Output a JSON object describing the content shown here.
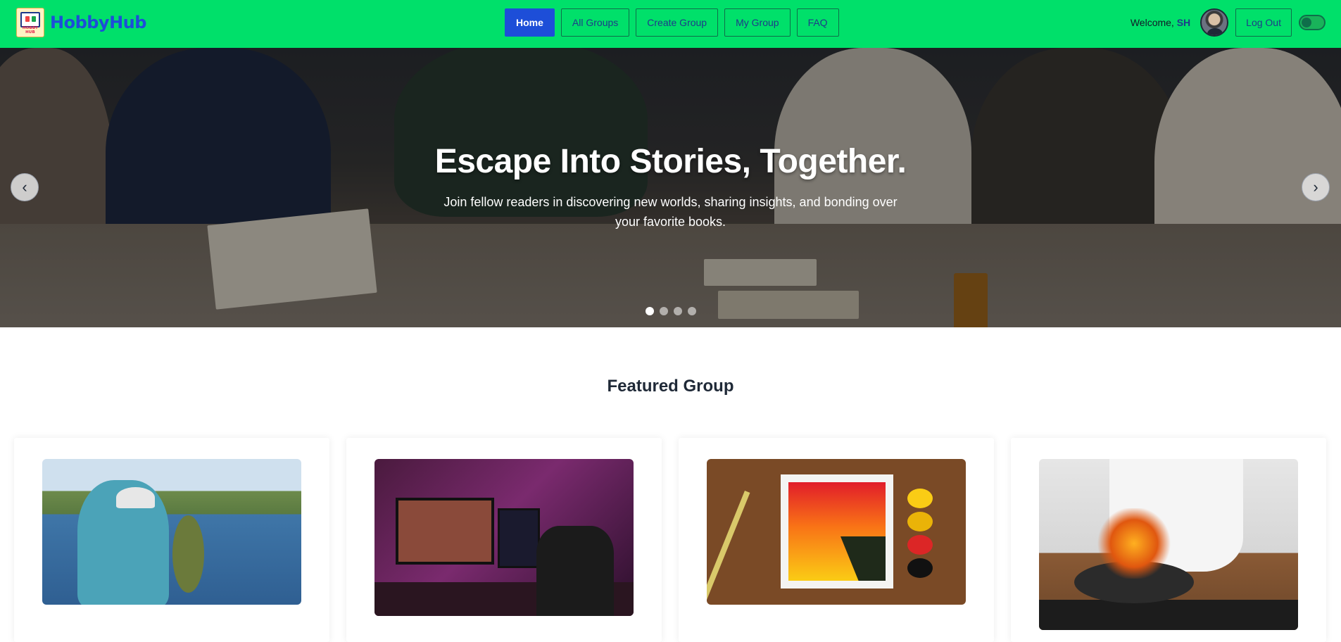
{
  "brand": {
    "logo_text": "HOBBY HUB",
    "name": "HobbyHub"
  },
  "nav": {
    "links": [
      "Home",
      "All Groups",
      "Create Group",
      "My Group",
      "FAQ"
    ],
    "active": "Home"
  },
  "user": {
    "welcome_prefix": "Welcome,",
    "name": "SH",
    "logout_label": "Log Out",
    "theme_toggle_on": false
  },
  "hero": {
    "title": "Escape Into Stories, Together.",
    "subtitle": "Join fellow readers in discovering new worlds, sharing insights, and bonding over your favorite books.",
    "prev_icon": "‹",
    "next_icon": "›",
    "slide_count": 4,
    "active_slide": 1
  },
  "featured": {
    "title": "Featured Group",
    "cards": [
      {
        "image": "fishing-photo"
      },
      {
        "image": "gaming-photo"
      },
      {
        "image": "painting-photo"
      },
      {
        "image": "cooking-photo"
      }
    ]
  },
  "colors": {
    "navbar_bg": "#00e06a",
    "accent": "#1d4ed8"
  }
}
